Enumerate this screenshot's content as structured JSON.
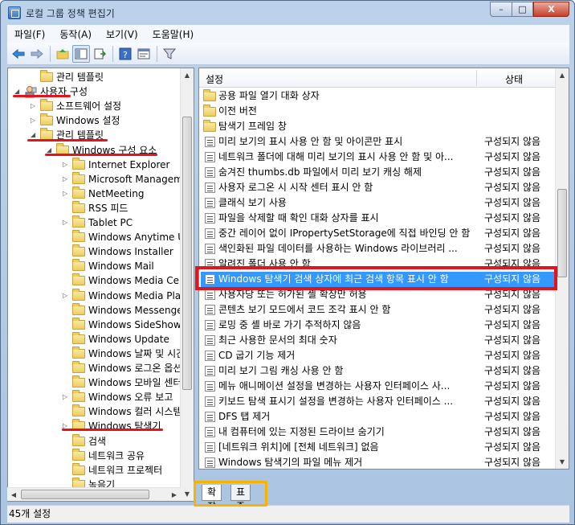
{
  "window": {
    "title": "로컬 그룹 정책 편집기",
    "close": "X",
    "minimize": "–",
    "maximize": "□"
  },
  "menu": [
    "파일(F)",
    "동작(A)",
    "보기(V)",
    "도움말(H)"
  ],
  "toolbar_icons": [
    "back-icon",
    "forward-icon",
    "up-folder-icon",
    "show-hide-tree-icon",
    "export-list-icon",
    "help-icon",
    "properties-icon",
    "filter-icon"
  ],
  "tree": [
    {
      "label": "관리 템플릿",
      "indent": 1,
      "expander": "",
      "icon": "folder"
    },
    {
      "label": "사용자 구성",
      "indent": 0,
      "expander": "◢",
      "icon": "user"
    },
    {
      "label": "소프트웨어 설정",
      "indent": 1,
      "expander": "▷",
      "icon": "folder"
    },
    {
      "label": "Windows 설정",
      "indent": 1,
      "expander": "▷",
      "icon": "folder"
    },
    {
      "label": "관리 템플릿",
      "indent": 1,
      "expander": "◢",
      "icon": "folder"
    },
    {
      "label": "Windows 구성 요소",
      "indent": 2,
      "expander": "◢",
      "icon": "folder"
    },
    {
      "label": "Internet Explorer",
      "indent": 3,
      "expander": "▷",
      "icon": "folder"
    },
    {
      "label": "Microsoft Manageme",
      "indent": 3,
      "expander": "▷",
      "icon": "folder"
    },
    {
      "label": "NetMeeting",
      "indent": 3,
      "expander": "▷",
      "icon": "folder"
    },
    {
      "label": "RSS 피드",
      "indent": 3,
      "expander": "",
      "icon": "folder"
    },
    {
      "label": "Tablet PC",
      "indent": 3,
      "expander": "▷",
      "icon": "folder"
    },
    {
      "label": "Windows Anytime Up",
      "indent": 3,
      "expander": "",
      "icon": "folder"
    },
    {
      "label": "Windows Installer",
      "indent": 3,
      "expander": "",
      "icon": "folder"
    },
    {
      "label": "Windows Mail",
      "indent": 3,
      "expander": "",
      "icon": "folder"
    },
    {
      "label": "Windows Media Cent",
      "indent": 3,
      "expander": "",
      "icon": "folder"
    },
    {
      "label": "Windows Media Playe",
      "indent": 3,
      "expander": "▷",
      "icon": "folder"
    },
    {
      "label": "Windows Messenger",
      "indent": 3,
      "expander": "",
      "icon": "folder"
    },
    {
      "label": "Windows SideShow",
      "indent": 3,
      "expander": "",
      "icon": "folder"
    },
    {
      "label": "Windows Update",
      "indent": 3,
      "expander": "",
      "icon": "folder"
    },
    {
      "label": "Windows 날짜 및 시간",
      "indent": 3,
      "expander": "",
      "icon": "folder"
    },
    {
      "label": "Windows 로그온 옵션",
      "indent": 3,
      "expander": "",
      "icon": "folder"
    },
    {
      "label": "Windows 모바일 센터",
      "indent": 3,
      "expander": "",
      "icon": "folder"
    },
    {
      "label": "Windows 오류 보고",
      "indent": 3,
      "expander": "▷",
      "icon": "folder"
    },
    {
      "label": "Windows 컬러 시스템",
      "indent": 3,
      "expander": "",
      "icon": "folder"
    },
    {
      "label": "Windows 탐색기",
      "indent": 3,
      "expander": "▷",
      "icon": "folder"
    },
    {
      "label": "검색",
      "indent": 3,
      "expander": "",
      "icon": "folder"
    },
    {
      "label": "네트워크 공유",
      "indent": 3,
      "expander": "",
      "icon": "folder"
    },
    {
      "label": "네트워크 프로젝터",
      "indent": 3,
      "expander": "",
      "icon": "folder"
    },
    {
      "label": "녹음기",
      "indent": 3,
      "expander": "",
      "icon": "folder"
    }
  ],
  "columns": {
    "setting": "설정",
    "status": "상태"
  },
  "rows": [
    {
      "name": "공용 파일 열기 대화 상자",
      "status": "",
      "type": "folder"
    },
    {
      "name": "이전 버전",
      "status": "",
      "type": "folder"
    },
    {
      "name": "탐색기 프레임 창",
      "status": "",
      "type": "folder"
    },
    {
      "name": "미리 보기의 표시 사용 안 함 및 아이콘만 표시",
      "status": "구성되지 않음",
      "type": "policy"
    },
    {
      "name": "네트워크 폴더에 대해 미리 보기의 표시 사용 안 함 및 아...",
      "status": "구성되지 않음",
      "type": "policy"
    },
    {
      "name": "숨겨진 thumbs.db 파일에서 미리 보기 캐싱 해제",
      "status": "구성되지 않음",
      "type": "policy"
    },
    {
      "name": "사용자 로그온 시 시작 센터 표시 안 함",
      "status": "구성되지 않음",
      "type": "policy"
    },
    {
      "name": "클래식 보기 사용",
      "status": "구성되지 않음",
      "type": "policy"
    },
    {
      "name": "파일을 삭제할 때 확인 대화 상자를 표시",
      "status": "구성되지 않음",
      "type": "policy"
    },
    {
      "name": "중간 레이어 없이 IPropertySetStorage에 직접 바인딩 안 함",
      "status": "구성되지 않음",
      "type": "policy"
    },
    {
      "name": "색인화된 파일 데이터를 사용하는 Windows 라이브러리 ...",
      "status": "구성되지 않음",
      "type": "policy"
    },
    {
      "name": "알려진 폴더 사용 안 함",
      "status": "구성되지 않음",
      "type": "policy"
    },
    {
      "name": "Windows 탐색기 검색 상자에 최근 검색 항목 표시 안 함",
      "status": "구성되지 않음",
      "type": "policy",
      "selected": true
    },
    {
      "name": "사용자당 또는 허가된 셸 확장만 허용",
      "status": "구성되지 않음",
      "type": "policy"
    },
    {
      "name": "콘텐츠 보기 모드에서 코드 조각 표시 안 함",
      "status": "구성되지 않음",
      "type": "policy"
    },
    {
      "name": "로밍 중 셸 바로 가기 추적하지 않음",
      "status": "구성되지 않음",
      "type": "policy"
    },
    {
      "name": "최근 사용한 문서의 최대 숫자",
      "status": "구성되지 않음",
      "type": "policy"
    },
    {
      "name": "CD 굽기 기능 제거",
      "status": "구성되지 않음",
      "type": "policy"
    },
    {
      "name": "미리 보기 그림 캐싱 사용 안 함",
      "status": "구성되지 않음",
      "type": "policy"
    },
    {
      "name": "메뉴 애니메이션 설정을 변경하는 사용자 인터페이스 사...",
      "status": "구성되지 않음",
      "type": "policy"
    },
    {
      "name": "키보드 탐색 표시기 설정을 변경하는 사용자 인터페이스 ...",
      "status": "구성되지 않음",
      "type": "policy"
    },
    {
      "name": "DFS 탭 제거",
      "status": "구성되지 않음",
      "type": "policy"
    },
    {
      "name": "내 컴퓨터에 있는 지정된 드라이브 숨기기",
      "status": "구성되지 않음",
      "type": "policy"
    },
    {
      "name": "[네트워크 위치]에 [전체 네트워크] 없음",
      "status": "구성되지 않음",
      "type": "policy"
    },
    {
      "name": "Windows 탐색기의 파일 메뉴 제거",
      "status": "구성되지 않음",
      "type": "policy"
    }
  ],
  "tabs": {
    "expanded": "확장",
    "standard": "표준"
  },
  "status_bar": "45개 설정",
  "colors": {
    "annotation_red": "#e5131b",
    "annotation_yellow": "#f6b400",
    "selection": "#3399ff"
  }
}
